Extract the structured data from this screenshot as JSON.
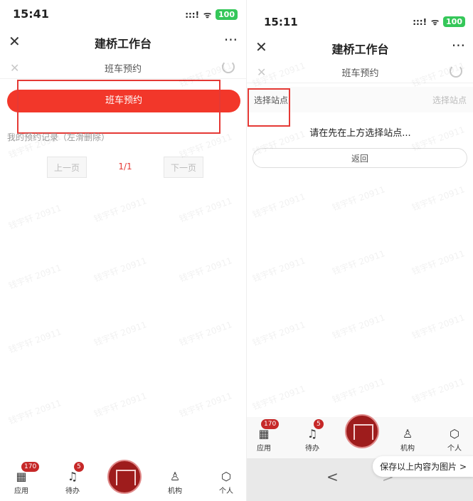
{
  "left": {
    "status": {
      "time": "15:41",
      "signal": ":::!",
      "wifi": "ᯤ",
      "battery": "100"
    },
    "title_bar": {
      "close": "✕",
      "title": "建桥工作台",
      "more": "···"
    },
    "sub_bar": {
      "close": "✕",
      "title": "班车预约"
    },
    "primary_button": "班车预约",
    "record_note": "我的预约记录（左滑删除）",
    "pager": {
      "prev": "上一页",
      "page": "1/1",
      "next": "下一页"
    }
  },
  "right": {
    "status": {
      "time": "15:11",
      "signal": ":::!",
      "wifi": "ᯤ",
      "battery": "100"
    },
    "title_bar": {
      "close": "✕",
      "title": "建桥工作台",
      "more": "···"
    },
    "sub_bar": {
      "close": "✕",
      "title": "班车预约"
    },
    "station_select_left": "选择站点",
    "station_select_right": "选择站点",
    "prompt": "请在先在上方选择站点...",
    "back_button": "返回",
    "nav": {
      "back": "<",
      "forward": ">"
    },
    "save_toast": "保存以上内容为图片 >"
  },
  "tabs": {
    "apps": {
      "label": "应用",
      "badge": "170"
    },
    "todo": {
      "label": "待办",
      "badge": "5"
    },
    "org": {
      "label": "机构"
    },
    "me": {
      "label": "个人"
    }
  },
  "watermark": "钱宇轩 20911",
  "colors": {
    "accent": "#f2372a",
    "highlight": "#e53935",
    "badge": "#c62828"
  }
}
